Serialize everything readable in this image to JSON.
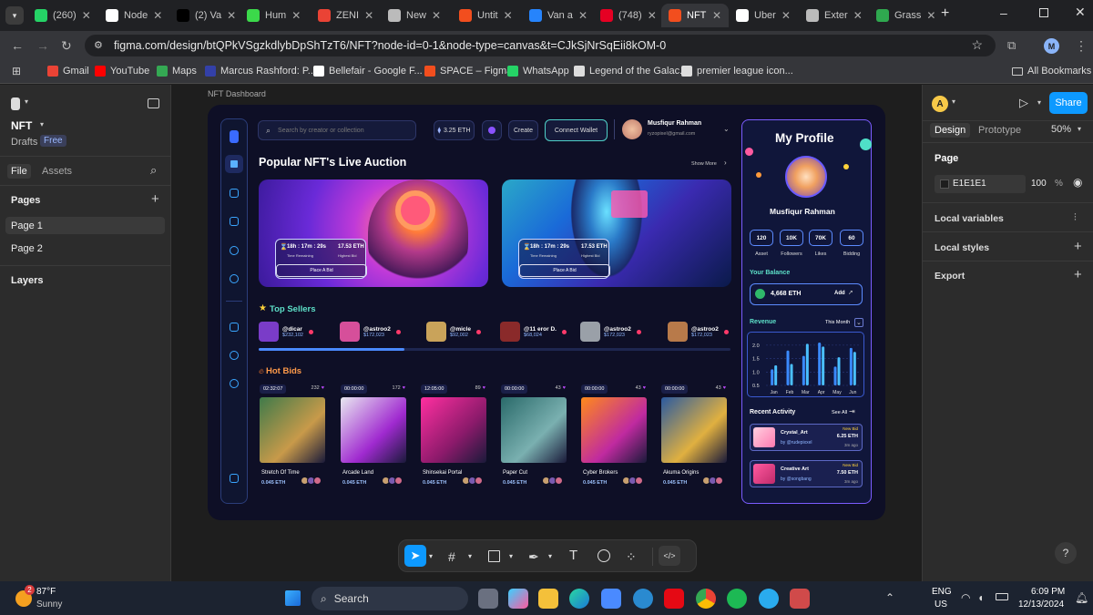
{
  "browser": {
    "tabs": [
      {
        "label": "(260)",
        "color": "#25d366"
      },
      {
        "label": "Node",
        "color": "#ffffff"
      },
      {
        "label": "(2) Va",
        "color": "#000000"
      },
      {
        "label": "Hum",
        "color": "#3bd94a"
      },
      {
        "label": "ZENI",
        "color": "#ea4335"
      },
      {
        "label": "New",
        "color": "#bbbbbb"
      },
      {
        "label": "Untit",
        "color": "#f24e1e"
      },
      {
        "label": "Van a",
        "color": "#2684fc"
      },
      {
        "label": "(748)",
        "color": "#e60023"
      },
      {
        "label": "NFT",
        "color": "#f24e1e"
      },
      {
        "label": "Uber",
        "color": "#ffffff"
      },
      {
        "label": "Exter",
        "color": "#bbbbbb"
      },
      {
        "label": "Grass",
        "color": "#2fa84f"
      }
    ],
    "url": "figma.com/design/btQPkVSgzkdlybDpShTzT6/NFT?node-id=0-1&node-type=canvas&t=CJkSjNrSqEii8kOM-0",
    "profile_initial": "M",
    "bookmarks": [
      {
        "label": "Gmail",
        "color": "#ea4335"
      },
      {
        "label": "YouTube",
        "color": "#ff0000"
      },
      {
        "label": "Maps",
        "color": "#34a853"
      },
      {
        "label": "Marcus Rashford: P...",
        "color": "#3340a8"
      },
      {
        "label": "Bellefair - Google F...",
        "color": "#ffffff"
      },
      {
        "label": "SPACE – Figma",
        "color": "#f24e1e"
      },
      {
        "label": "WhatsApp",
        "color": "#25d366"
      },
      {
        "label": "Legend of the Galac...",
        "color": "#dddddd"
      },
      {
        "label": "premier league icon...",
        "color": "#dddddd"
      }
    ],
    "all_bookmarks": "All Bookmarks"
  },
  "figma": {
    "file_name": "NFT",
    "drafts": "Drafts",
    "plan": "Free",
    "tab_file": "File",
    "tab_assets": "Assets",
    "pages_heading": "Pages",
    "pages": [
      "Page 1",
      "Page 2"
    ],
    "layers_heading": "Layers",
    "frame_label": "NFT Dashboard",
    "right": {
      "avatar_initial": "A",
      "share": "Share",
      "tab_design": "Design",
      "tab_prototype": "Prototype",
      "zoom": "50%",
      "page_heading": "Page",
      "page_color": "E1E1E1",
      "page_opacity": "100",
      "percent": "%",
      "local_variables": "Local variables",
      "local_styles": "Local styles",
      "export": "Export"
    }
  },
  "nft": {
    "search_placeholder": "Search by creator or collection",
    "balance_chip": "3.25 ETH",
    "create": "Create",
    "connect": "Connect Wallet",
    "user_name": "Musfiqur Rahman",
    "user_email": "ryzopixel@gmail.com",
    "section_title": "Popular NFT's Live Auction",
    "show_more": "Show More",
    "auctions": [
      {
        "time": "18h : 17m : 29s",
        "time_label": "Time Remaining",
        "bid": "17.53 ETH",
        "bid_label": "Highest Bid",
        "button": "Place A Bid"
      },
      {
        "time": "18h : 17m : 29s",
        "time_label": "Time Remaining",
        "bid": "17.53 ETH",
        "bid_label": "Highest Bid",
        "button": "Place A Bid"
      }
    ],
    "top_sellers_title": "Top Sellers",
    "sellers": [
      {
        "name": "@dicar",
        "value": "$232,102",
        "color": "#7a3cc8"
      },
      {
        "name": "@astroo2",
        "value": "$172,023",
        "color": "#d64f9a"
      },
      {
        "name": "@micle",
        "value": "$92,002",
        "color": "#c9a35a"
      },
      {
        "name": "@11 eror D.",
        "value": "$68,024",
        "color": "#8a2a2a"
      },
      {
        "name": "@astroo2",
        "value": "$172,023",
        "color": "#9aa0a8"
      },
      {
        "name": "@astroo2",
        "value": "$172,023",
        "color": "#b87a4a"
      }
    ],
    "hot_bids_title": "Hot Bids",
    "bids": [
      {
        "time": "02:32:07",
        "likes": "232",
        "title": "Stretch Of Time",
        "price": "0.045 ETH",
        "c1": "#3f7a4a",
        "c2": "#c89a4a"
      },
      {
        "time": "00:00:00",
        "likes": "172",
        "title": "Arcade Land",
        "price": "0.045 ETH",
        "c1": "#e8e8f0",
        "c2": "#a02ad0"
      },
      {
        "time": "12:05:00",
        "likes": "89",
        "title": "Shinsekai Portal",
        "price": "0.045 ETH",
        "c1": "#ff2fa0",
        "c2": "#8a1a6a"
      },
      {
        "time": "00:00:00",
        "likes": "43",
        "title": "Paper Cut",
        "price": "0.045 ETH",
        "c1": "#2a6a6a",
        "c2": "#7ab0b0"
      },
      {
        "time": "00:00:00",
        "likes": "43",
        "title": "Cyber Brokers",
        "price": "0.045 ETH",
        "c1": "#ff8a1a",
        "c2": "#c02aa0"
      },
      {
        "time": "00:00:00",
        "likes": "43",
        "title": "Akuma Origins",
        "price": "0.045 ETH",
        "c1": "#2a5aa0",
        "c2": "#e0b040"
      }
    ],
    "profile": {
      "heading": "My Profile",
      "name": "Musfiqur Rahman",
      "stats": [
        {
          "value": "120",
          "label": "Asset"
        },
        {
          "value": "10K",
          "label": "Followers"
        },
        {
          "value": "70K",
          "label": "Likes"
        },
        {
          "value": "60",
          "label": "Bidding"
        }
      ],
      "balance_title": "Your Balance",
      "balance": "4,668 ETH",
      "add": "Add",
      "revenue_title": "Revenue",
      "revenue_period": "This Month",
      "recent_title": "Recent Activity",
      "see_all": "See All",
      "activity": [
        {
          "title": "Crystal_Art",
          "by": "by @rudepixxel",
          "bid_label": "New Bid",
          "bid": "6.25 ETH",
          "ago": "3m ago"
        },
        {
          "title": "Creative Art",
          "by": "by @songbang",
          "bid_label": "New Bid",
          "bid": "7.50 ETH",
          "ago": "3m ago"
        }
      ]
    },
    "chart_data": {
      "type": "bar",
      "categories": [
        "Jan",
        "Feb",
        "Mar",
        "Apr",
        "May",
        "Jun"
      ],
      "series": [
        {
          "values": [
            1.1,
            1.8,
            1.6,
            2.1,
            1.2,
            1.9
          ]
        },
        {
          "values": [
            1.25,
            1.3,
            2.05,
            1.95,
            1.55,
            1.75
          ]
        }
      ],
      "yticks": [
        "2.0",
        "1.5",
        "1.0",
        "0.5"
      ],
      "ylim": [
        0.5,
        2.2
      ]
    }
  },
  "taskbar": {
    "weather_badge": "2",
    "temp": "87°F",
    "condition": "Sunny",
    "search": "Search",
    "lang1": "ENG",
    "lang2": "US",
    "time": "6:09 PM",
    "date": "12/13/2024"
  }
}
